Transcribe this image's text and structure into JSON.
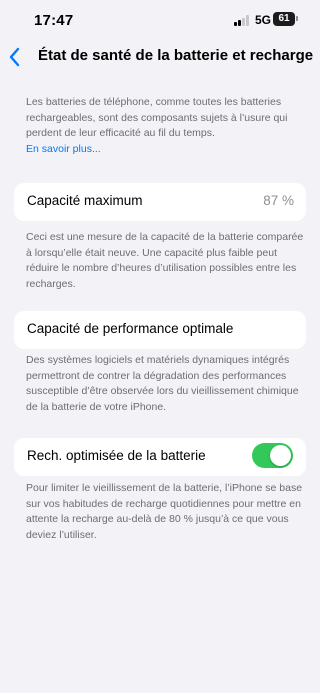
{
  "status_bar": {
    "time": "17:47",
    "network": "5G",
    "battery": "61"
  },
  "nav": {
    "title": "État de santé de la batterie et recharge",
    "back_icon": "chevron-left-icon"
  },
  "intro": {
    "text": "Les batteries de téléphone, comme toutes les batteries rechargeables, sont des composants sujets à l’usure qui perdent de leur efficacité au fil du temps.",
    "link": "En savoir plus..."
  },
  "max_capacity": {
    "label": "Capacité maximum",
    "value": "87 %",
    "description": "Ceci est une mesure de la capacité de la batterie comparée à lorsqu’elle était neuve. Une capacité plus faible peut réduire le nombre d’heures d’utilisation possibles entre les recharges."
  },
  "performance": {
    "label": "Capacité de performance optimale",
    "description": "Des systèmes logiciels et matériels dynamiques intégrés permettront de contrer la dégradation des performances susceptible d’être observée lors du vieillissement chimique de la batterie de votre iPhone."
  },
  "optimized_charging": {
    "label": "Rech. optimisée de la batterie",
    "enabled": true,
    "description": "Pour limiter le vieillissement de la batterie, l’iPhone se base sur vos habitudes de recharge quotidiennes pour mettre en attente la recharge au-delà de 80 % jusqu’à ce que vous deviez l’utiliser."
  },
  "colors": {
    "accent": "#007aff",
    "toggle_on": "#34c759",
    "background": "#f2f2f7",
    "secondary_text": "#6d6d72"
  }
}
